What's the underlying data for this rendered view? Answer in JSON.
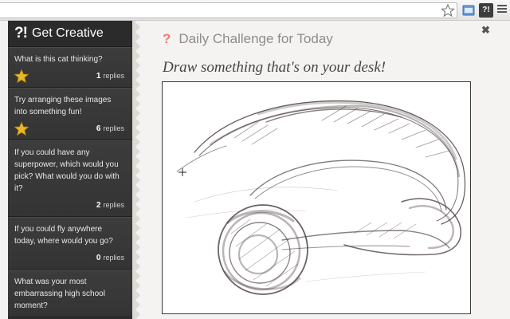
{
  "app": {
    "logo": "?!",
    "title": "Get Creative"
  },
  "sidebar": {
    "items": [
      {
        "question": "What is this cat thinking?",
        "starred": true,
        "reply_count": "1",
        "reply_label": "replies"
      },
      {
        "question": "Try arranging these images into something fun!",
        "starred": true,
        "reply_count": "6",
        "reply_label": "replies"
      },
      {
        "question": "If you could have any superpower, which would you pick? What would you do with it?",
        "starred": false,
        "reply_count": "2",
        "reply_label": "replies"
      },
      {
        "question": "If you could fly anywhere today, where would you go?",
        "starred": false,
        "reply_count": "0",
        "reply_label": "replies"
      },
      {
        "question": "What was your most embarrassing high school moment?",
        "starred": false,
        "reply_count": "",
        "reply_label": ""
      }
    ]
  },
  "main": {
    "challenge_icon": "?",
    "challenge_title": "Daily Challenge for Today",
    "prompt": "Draw something that's on your desk!",
    "close_glyph": "✖"
  },
  "icons": {
    "bookmark": "star-outline-icon",
    "extension": "extension-icon",
    "menu": "hamburger-menu-icon",
    "cursor": "crosshair-cursor-icon",
    "badge": "gold-star-icon"
  },
  "colors": {
    "sidebar_bg": "#333333",
    "accent_question": "#e87d74",
    "star_gold": "#e8b82a"
  }
}
